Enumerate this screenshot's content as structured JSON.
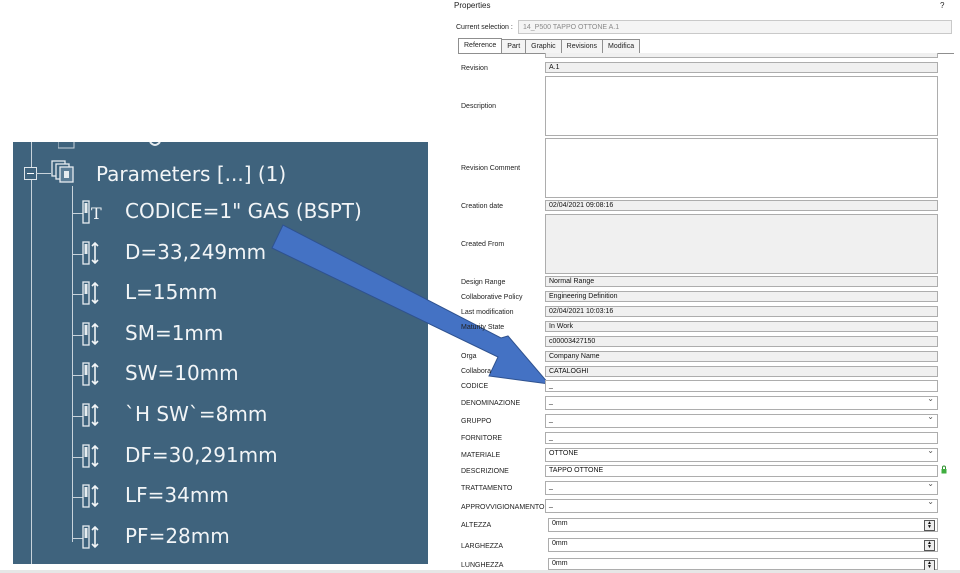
{
  "tree": {
    "root_label": "Parameters [...] (1)",
    "items": [
      {
        "label": "CODICE=1\" GAS (BSPT)",
        "icon": "text-parameter-icon"
      },
      {
        "label": "D=33,249mm",
        "icon": "length-parameter-icon"
      },
      {
        "label": "L=15mm",
        "icon": "length-parameter-icon"
      },
      {
        "label": "SM=1mm",
        "icon": "length-parameter-icon"
      },
      {
        "label": "SW=10mm",
        "icon": "length-parameter-icon"
      },
      {
        "label": "`H SW`=8mm",
        "icon": "length-parameter-icon"
      },
      {
        "label": "DF=30,291mm",
        "icon": "length-parameter-icon"
      },
      {
        "label": "LF=34mm",
        "icon": "length-parameter-icon"
      },
      {
        "label": "PF=28mm",
        "icon": "length-parameter-icon"
      }
    ]
  },
  "colors": {
    "tree_bg": "#3f637d",
    "arrow": "#4472c4"
  },
  "properties": {
    "title": "Properties",
    "help": "?",
    "current_selection_label": "Current selection :",
    "current_selection_value": "14_P500 TAPPO OTTONE A.1",
    "tabs": [
      "Reference",
      "Part",
      "Graphic",
      "Revisions",
      "Modifica"
    ],
    "active_tab": "Reference",
    "fields": {
      "revision": {
        "label": "Revision",
        "value": "A.1"
      },
      "description": {
        "label": "Description",
        "value": ""
      },
      "revision_comment": {
        "label": "Revision Comment",
        "value": ""
      },
      "creation_date": {
        "label": "Creation date",
        "value": "02/04/2021 09:08:16"
      },
      "created_from": {
        "label": "Created From",
        "value": ""
      },
      "design_range": {
        "label": "Design Range",
        "value": "Normal Range"
      },
      "collaborative_policy": {
        "label": "Collaborative Policy",
        "value": "Engineering Definition"
      },
      "last_modification": {
        "label": "Last modification",
        "value": "02/04/2021 10:03:16"
      },
      "maturity_state": {
        "label": "Maturity State",
        "value": "In Work"
      },
      "owner": {
        "label": "",
        "value": "c00003427150"
      },
      "organization": {
        "label": "Orga",
        "value": "Company Name"
      },
      "collaborative_space": {
        "label": "Collabora",
        "value": "CATALOGHI"
      },
      "codice": {
        "label": "CODICE",
        "value": "_"
      },
      "denominazione": {
        "label": "DENOMINAZIONE",
        "value": "_"
      },
      "gruppo": {
        "label": "GRUPPO",
        "value": "_"
      },
      "fornitore": {
        "label": "FORNITORE",
        "value": "_"
      },
      "materiale": {
        "label": "MATERIALE",
        "value": "OTTONE"
      },
      "descrizione": {
        "label": "DESCRIZIONE",
        "value": "TAPPO OTTONE"
      },
      "trattamento": {
        "label": "TRATTAMENTO",
        "value": "_"
      },
      "approvvigionamento": {
        "label": "APPROVVIGIONAMENTO",
        "value": "_"
      },
      "altezza": {
        "label": "ALTEZZA",
        "value": "0mm"
      },
      "larghezza": {
        "label": "LARGHEZZA",
        "value": "0mm"
      },
      "lunghezza": {
        "label": "LUNGHEZZA",
        "value": "0mm"
      }
    }
  }
}
